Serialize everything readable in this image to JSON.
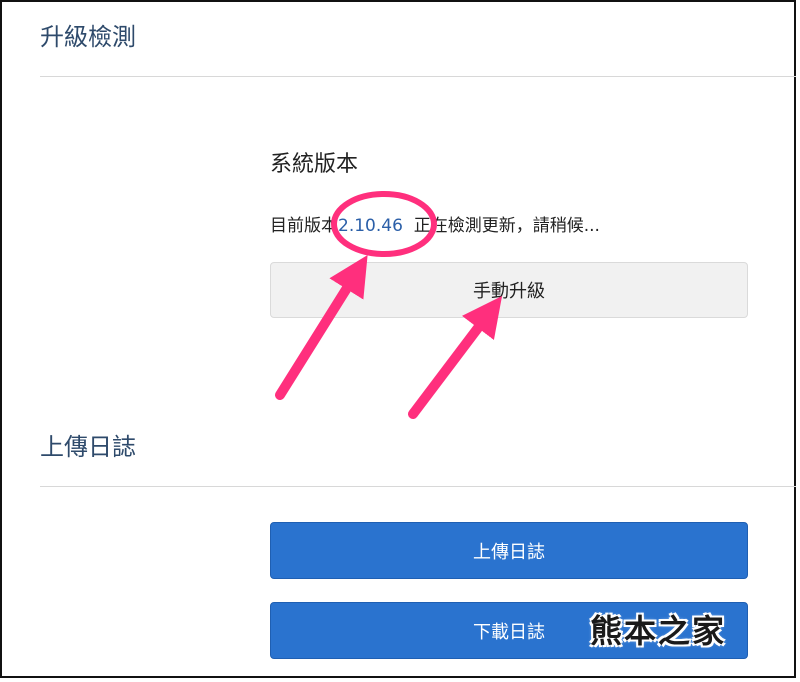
{
  "upgrade_section": {
    "title": "升級檢測",
    "system_version_label": "系統版本",
    "version_prefix": "目前版本",
    "version_number": "2.10.46",
    "version_status": "正在檢測更新，請稍候...",
    "manual_upgrade_button": "手動升級"
  },
  "log_section": {
    "title": "上傳日誌",
    "upload_button": "上傳日誌",
    "download_button": "下載日誌"
  },
  "annotation": {
    "highlight_color": "#ff2f7d"
  },
  "watermark": {
    "text": "熊本之家"
  }
}
